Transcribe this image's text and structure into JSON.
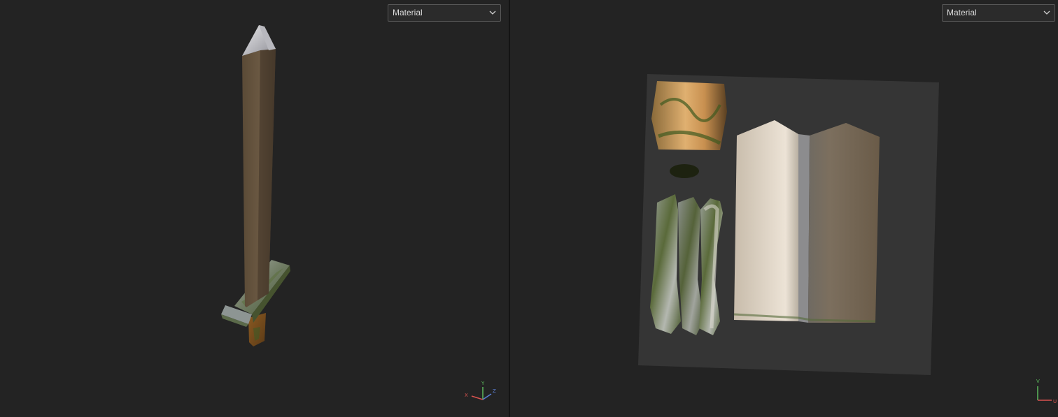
{
  "left_viewport": {
    "shading_mode": "Material",
    "axis_labels": {
      "x": "X",
      "y": "Y",
      "z": "Z"
    }
  },
  "right_viewport": {
    "shading_mode": "Material",
    "axis_labels": {
      "y": "V",
      "x": "U"
    }
  },
  "icons": {
    "dropdown": "chevron-down-icon",
    "axis_gizmo": "axis-gizmo-icon"
  },
  "colors": {
    "background": "#232323",
    "axis_x": "#d9534f",
    "axis_y": "#5cb85c",
    "axis_z": "#5b7fd6"
  }
}
